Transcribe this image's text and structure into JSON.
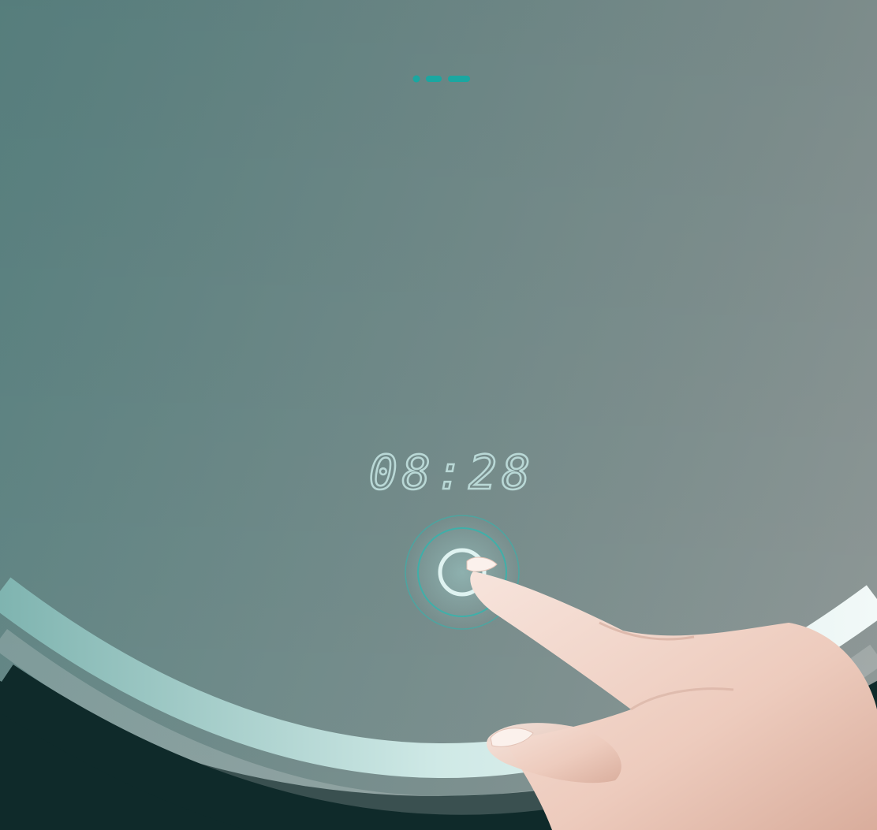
{
  "mirror": {
    "clock": {
      "time": "08:28"
    },
    "status_indicator": {
      "icon": "status-dots-icon"
    },
    "touch_button": {
      "icon": "power-ring-icon"
    },
    "colors": {
      "glass_left": "#3f7a78",
      "glass_right": "#8e9694",
      "backlight_ring": "#c9e6e3",
      "frame_dark": "#0f2a2a",
      "indicator": "#1aa7a1",
      "display_text": "#b9d8d6"
    }
  }
}
